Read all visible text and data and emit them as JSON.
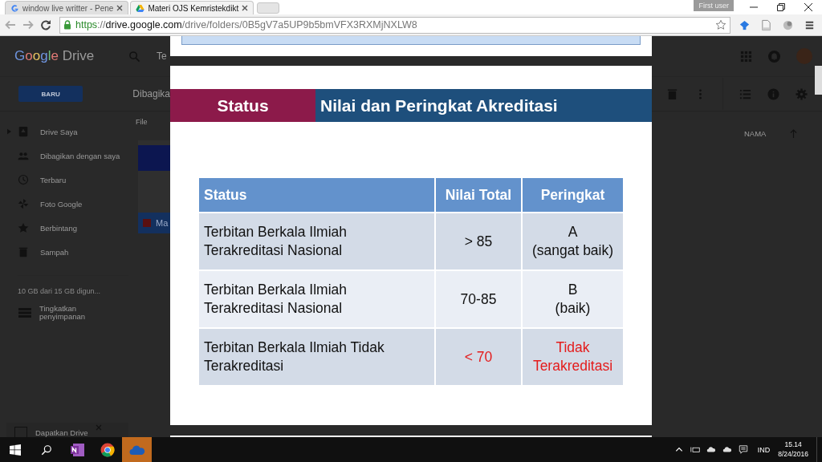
{
  "browser": {
    "tabs": [
      {
        "title": "window live writter - Pene",
        "selected": false
      },
      {
        "title": "Materi OJS Kemristekdikt",
        "selected": true
      }
    ],
    "profile": "First user",
    "address": [
      {
        "text": "https",
        "kind": "scheme"
      },
      {
        "text": "://",
        "kind": "path"
      },
      {
        "text": "drive.google.com",
        "kind": "host"
      },
      {
        "text": "/drive/folders/0B5gV7a5UP9b5bmVFX3RXMjNXLW8",
        "kind": "path"
      }
    ]
  },
  "drive": {
    "logo_brand": "Google",
    "logo_product": "Drive",
    "search_text": "Te",
    "new_button": "BARU",
    "breadcrumb": "Dibagika",
    "section": "File",
    "file_name": "Ma",
    "nav": [
      {
        "label": "Drive Saya",
        "expandable": true
      },
      {
        "label": "Dibagikan dengan saya",
        "expandable": false
      },
      {
        "label": "Terbaru",
        "expandable": false
      },
      {
        "label": "Foto Google",
        "expandable": false
      },
      {
        "label": "Berbintang",
        "expandable": false
      },
      {
        "label": "Sampah",
        "expandable": false
      }
    ],
    "storage": "10 GB dari 15 GB digun...",
    "upgrade": "Tingkatkan penyimpanan",
    "promo": "Dapatkan Drive",
    "sort_label": "NAMA"
  },
  "slide": {
    "header_left": "Status",
    "header_right": "Nilai dan Peringkat Akreditasi",
    "columns": [
      "Status",
      "Nilai Total",
      "Peringkat"
    ],
    "rows": [
      {
        "status": [
          "Terbitan Berkala Ilmiah",
          "Terakreditasi Nasional"
        ],
        "score": "> 85",
        "rank": [
          "A",
          "(sangat baik)"
        ],
        "alert": false
      },
      {
        "status": [
          "Terbitan Berkala Ilmiah",
          "Terakreditasi Nasional"
        ],
        "score": "70-85",
        "rank": [
          "B",
          "(baik)"
        ],
        "alert": false
      },
      {
        "status": [
          "Terbitan Berkala Ilmiah Tidak",
          "Terakreditasi"
        ],
        "score": "< 70",
        "rank": [
          "Tidak",
          "Terakreditasi"
        ],
        "alert": true
      }
    ]
  },
  "taskbar": {
    "apps": [
      {
        "selected": false
      },
      {
        "selected": false
      },
      {
        "selected": true
      }
    ],
    "language": "IND",
    "time": "15.14",
    "date": "8/24/2016"
  }
}
